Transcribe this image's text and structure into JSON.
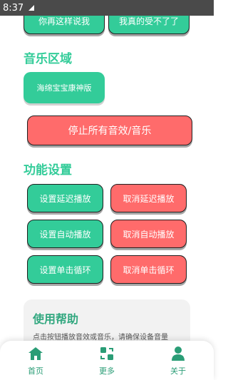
{
  "status_bar": {
    "time": "8:37"
  },
  "top_buttons": [
    {
      "label": "你再这样说我"
    },
    {
      "label": "我真的受不了了"
    }
  ],
  "music_section": {
    "title": "音乐区域",
    "music_button": "海绵宝宝康神版",
    "stop_all_button": "停止所有音效/音乐"
  },
  "settings_section": {
    "title": "功能设置",
    "buttons": [
      {
        "label": "设置延迟播放"
      },
      {
        "label": "取消延迟播放"
      },
      {
        "label": "设置自动播放"
      },
      {
        "label": "取消自动播放"
      },
      {
        "label": "设置单击循环"
      },
      {
        "label": "取消单击循环"
      }
    ]
  },
  "help": {
    "title": "使用帮助",
    "text": "点击按钮播放音效或音乐，请确保设备音量"
  },
  "bottom_nav": [
    {
      "label": "首页",
      "icon": "home-icon"
    },
    {
      "label": "更多",
      "icon": "more-icon"
    },
    {
      "label": "关于",
      "icon": "person-icon"
    }
  ],
  "colors": {
    "accent": "#33cc99",
    "danger": "#ff6b6b"
  }
}
